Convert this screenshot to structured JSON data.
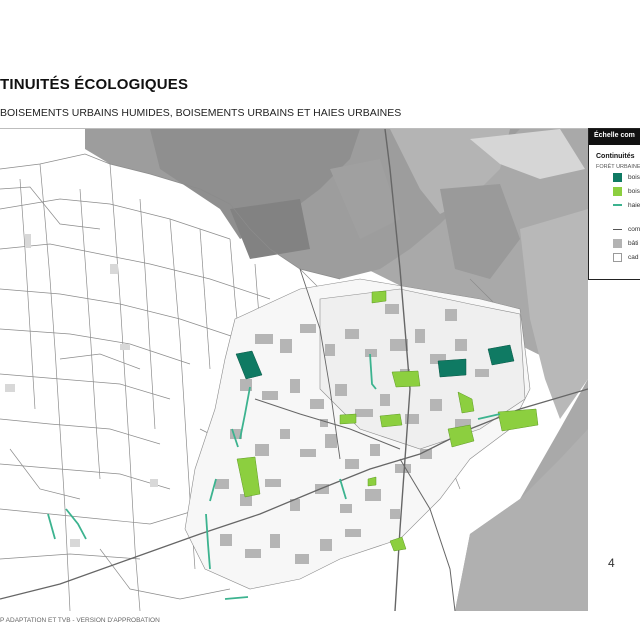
{
  "page": {
    "title": "TINUITÉS ÉCOLOGIQUES",
    "subtitle": "BOISEMENTS URBAINS HUMIDES, BOISEMENTS URBAINS ET HAIES URBAINES",
    "footer": "P ADAPTATION ET TVB - VERSION D'APPROBATION",
    "page_mark": "4"
  },
  "legend": {
    "scale_label": "Échelle com",
    "section_title": "Continuités",
    "group_label": "FORÊT URBAINE",
    "items": [
      {
        "label": "bois",
        "kind": "swatch",
        "color": "#0f7a63"
      },
      {
        "label": "bois",
        "kind": "swatch",
        "color": "#8ccf3f"
      },
      {
        "label": "haie",
        "kind": "line",
        "color": "#3cb38f"
      },
      {
        "label": "com",
        "kind": "line",
        "color": "#555555"
      },
      {
        "label": "bâti",
        "kind": "swatch",
        "color": "#b3b3b3"
      },
      {
        "label": "cad",
        "kind": "outline",
        "color": "#9a9a9a"
      }
    ]
  },
  "colors": {
    "wet_urban_woodland": "#0f7a63",
    "urban_woodland": "#8ccf3f",
    "urban_hedge": "#3cb38f",
    "aerial_background": "#a6a6a6",
    "building": "#b3b3b3"
  }
}
